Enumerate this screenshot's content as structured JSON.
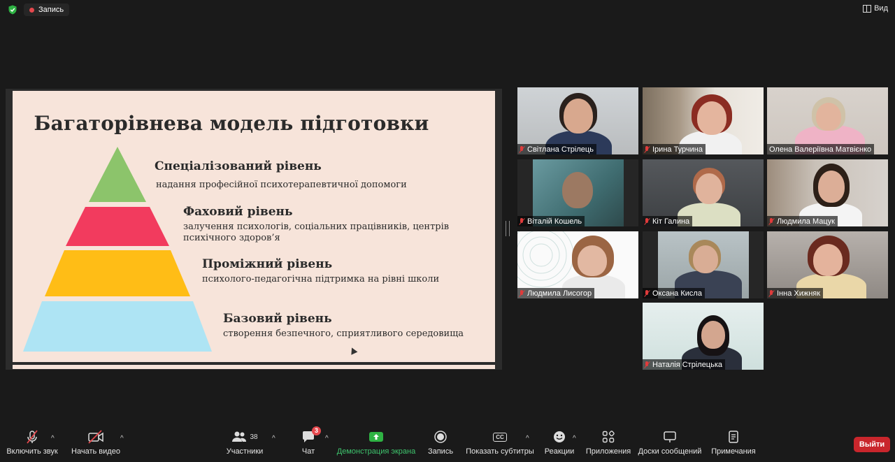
{
  "topbar": {
    "record_label": "Запись",
    "view_label": "Вид"
  },
  "slide": {
    "title": "Багаторівнева модель підготовки",
    "levels": [
      {
        "title": "Спеціалізований рівень",
        "desc": "надання професійної психотерапевтичної допомоги",
        "color": "#8cc46b"
      },
      {
        "title": "Фаховий рівень",
        "desc": "залучення психологів, соціальних працівників, центрів психічного здоров’я",
        "color": "#f23b5e"
      },
      {
        "title": "Проміжний рівень",
        "desc": "психолого-педагогічна підтримка на рівні школи",
        "color": "#ffbd16"
      },
      {
        "title": "Базовий рівень",
        "desc": "створення безпечного, сприятливого середовища",
        "color": "#aee4f4"
      }
    ],
    "background": "#f7e4da"
  },
  "participants": [
    {
      "name": "Світлана Стрілець",
      "muted": true,
      "active": false
    },
    {
      "name": "Ірина Турчина",
      "muted": true,
      "active": false
    },
    {
      "name": "Олена Валеріївна Матвієнко",
      "muted": false,
      "active": true
    },
    {
      "name": "Віталій Кошель",
      "muted": true,
      "active": false
    },
    {
      "name": "Кіт Галина",
      "muted": true,
      "active": false
    },
    {
      "name": "Людмила Мацук",
      "muted": true,
      "active": false
    },
    {
      "name": "Людмила Лисогор",
      "muted": true,
      "active": false
    },
    {
      "name": "Оксана Кисла",
      "muted": true,
      "active": false
    },
    {
      "name": "Інна Хижняк",
      "muted": true,
      "active": false
    },
    {
      "name": "Наталія Стрілецька",
      "muted": true,
      "active": false
    }
  ],
  "toolbar": {
    "unmute": "Включить звук",
    "start_video": "Начать видео",
    "participants": "Участники",
    "participants_count": "38",
    "chat": "Чат",
    "chat_badge": "3",
    "share": "Демонстрация экрана",
    "record": "Запись",
    "captions": "Показать субтитры",
    "captions_icon": "CC",
    "reactions": "Реакции",
    "apps": "Приложения",
    "whiteboards": "Доски сообщений",
    "notes": "Примечания",
    "leave": "Выйти"
  },
  "colors": {
    "active_speaker": "#a6d03b",
    "share_green": "#3ec46d",
    "leave": "#c9262c"
  }
}
